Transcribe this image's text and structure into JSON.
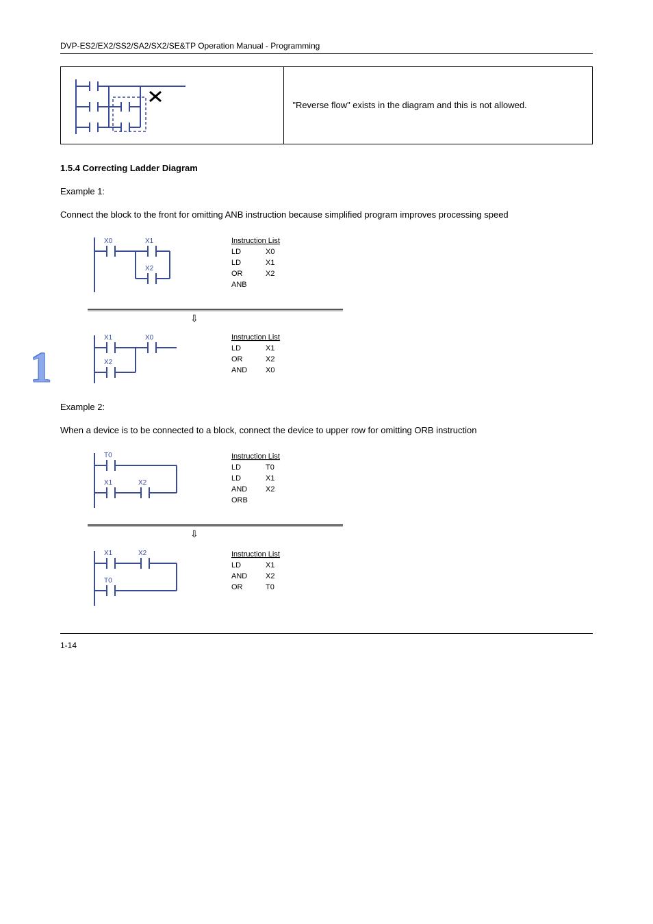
{
  "header": {
    "title": "DVP-ES2/EX2/SS2/SA2/SX2/SE&TP Operation Manual - Programming"
  },
  "table": {
    "right_text": "\"Reverse flow\" exists in the diagram and this is not allowed."
  },
  "section": {
    "heading": "1.5.4 Correcting Ladder Diagram",
    "intro": "Example 1:",
    "intro_text": [
      "Connect the block to the front for omitting ANB instruction because simplified program improves processing speed"
    ],
    "instruction_code_1a": "Instruction List\nLD    X0\nLD    X1\nOR    X2\nANB",
    "instruction_code_1b": "Instruction List\nLD    X1\nOR    X2\nAND   X0",
    "example2": "Example 2:",
    "example2_text": "When a device is to be connected to a block, connect the device to upper row for omitting ORB instruction",
    "instruction_code_2a": "Instruction List\nLD    T0\nLD    X1\nAND   X2\nORB",
    "instruction_code_2b": "Instruction List\nLD    X1\nAND   X2\nOR    T0"
  },
  "diagrams": {
    "ladder1": {
      "labels": [
        "X0",
        "X1",
        "X2"
      ]
    },
    "ladder2": {
      "labels": [
        "X1",
        "X0",
        "X2"
      ]
    },
    "ladder3": {
      "labels": [
        "T0",
        "X1",
        "X2"
      ]
    },
    "ladder4": {
      "labels": [
        "X1",
        "X2",
        "T0"
      ]
    }
  },
  "footer": {
    "page": "1-14"
  }
}
